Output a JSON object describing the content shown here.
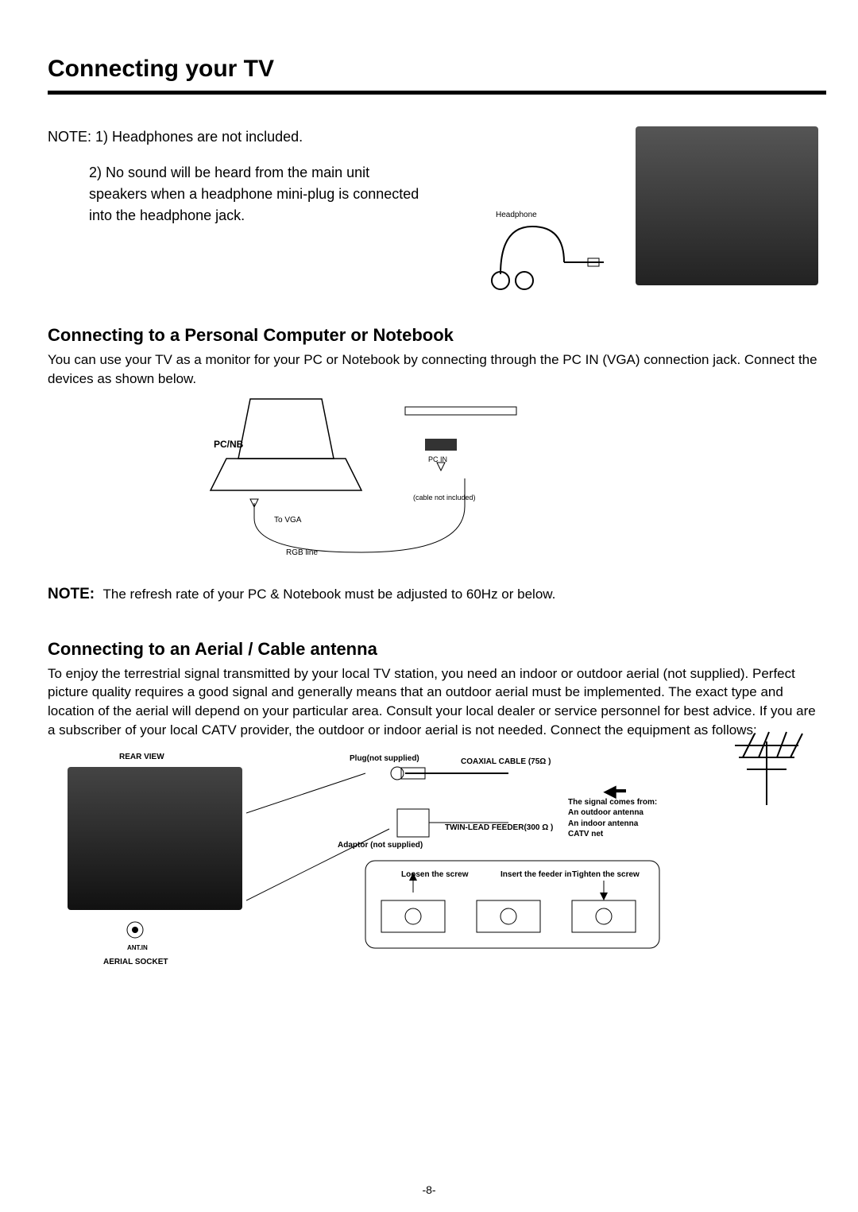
{
  "title": "Connecting your TV",
  "note_intro": "NOTE: 1) Headphones are not included.",
  "note_item2": "2) No sound will be heard from the main unit speakers when a headphone mini-plug is connected into the headphone jack.",
  "headphone_label": "Headphone",
  "section1": {
    "title": "Connecting to a Personal Computer or Notebook",
    "body": "You can use your TV as a monitor for your PC or Notebook by connecting through the PC IN (VGA) connection jack. Connect the devices as shown below.",
    "pcnb": "PC/NB",
    "to_vga": "To VGA",
    "rgb_line": "RGB line",
    "pc_in": "PC IN",
    "cable_note": "(cable not included)"
  },
  "note2_label": "NOTE:",
  "note2_text": "The refresh rate of your PC & Notebook must be adjusted to 60Hz or below.",
  "section2": {
    "title": "Connecting to an Aerial / Cable antenna",
    "body": "To enjoy the terrestrial signal transmitted by your local TV station, you need an indoor or outdoor aerial (not supplied). Perfect picture quality requires a good signal and generally means that an outdoor aerial must be implemented. The exact type and location of the aerial will depend on your particular area. Consult  your local dealer or service personnel for best advice. If you are a subscriber of your local CATV provider, the outdoor or indoor aerial is not needed. Connect the equipment as follows:",
    "rear_view": "REAR VIEW",
    "aerial_socket": "AERIAL SOCKET",
    "ant_in": "ANT.IN",
    "plug": "Plug(not supplied)",
    "coax": "COAXIAL CABLE (75Ω )",
    "twin": "TWIN-LEAD FEEDER(300 Ω )",
    "adaptor": "Adaptor (not supplied)",
    "signal_intro": "The signal comes from:",
    "signal1": "An  outdoor antenna",
    "signal2": "An  indoor antenna",
    "signal3": "CATV  net",
    "step1": "Loosen the screw",
    "step2": "Insert the feeder in",
    "step3": "Tighten the screw"
  },
  "page_number": "-8-"
}
